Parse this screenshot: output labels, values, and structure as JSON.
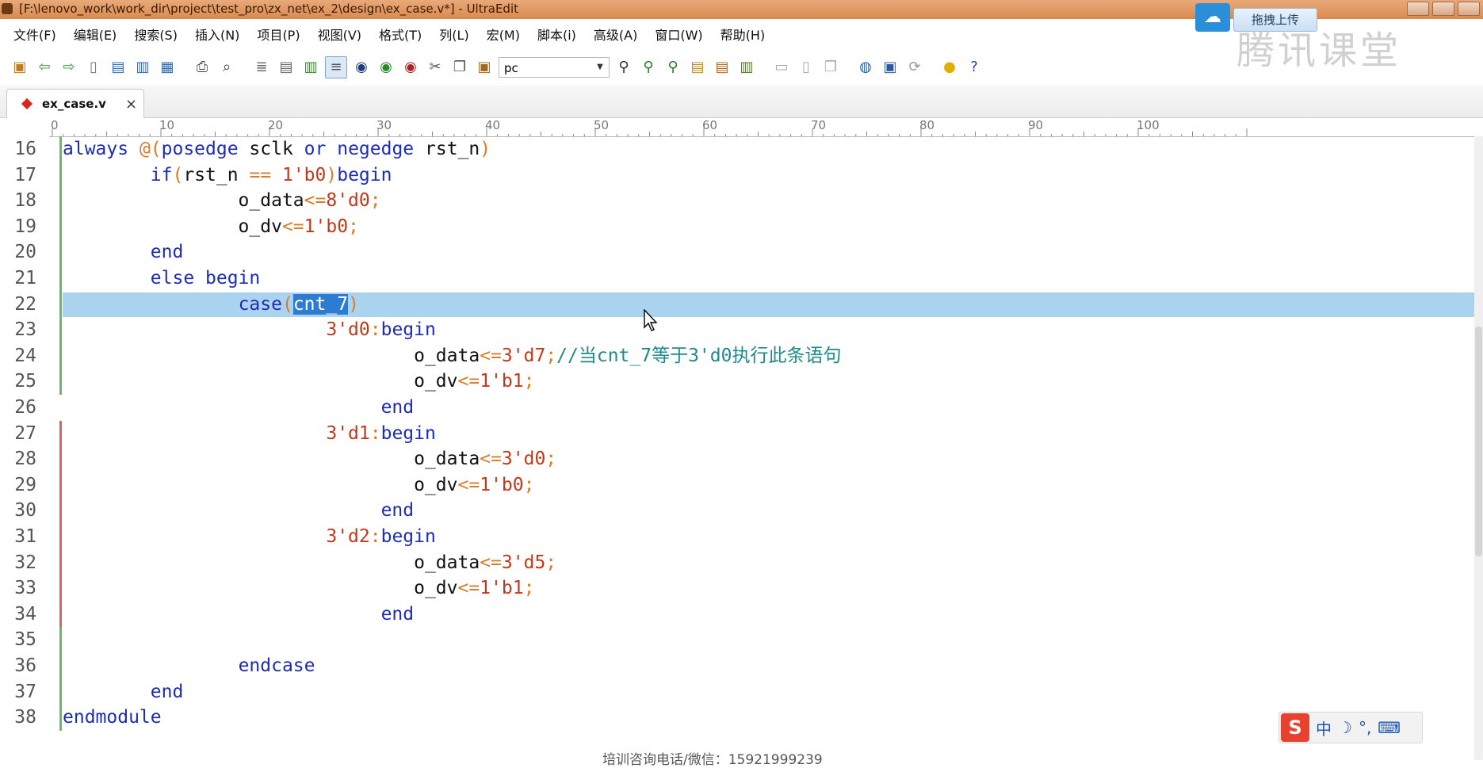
{
  "window": {
    "title": "[F:\\lenovo_work\\work_dir\\project\\test_pro\\zx_net\\ex_2\\design\\ex_case.v*] - UltraEdit"
  },
  "upload": {
    "label": "拖拽上传"
  },
  "brand": {
    "logo_text": "腾讯课堂"
  },
  "menu": {
    "items": [
      {
        "label": "文件(F)"
      },
      {
        "label": "编辑(E)"
      },
      {
        "label": "搜索(S)"
      },
      {
        "label": "插入(N)"
      },
      {
        "label": "项目(P)"
      },
      {
        "label": "视图(V)"
      },
      {
        "label": "格式(T)"
      },
      {
        "label": "列(L)"
      },
      {
        "label": "宏(M)"
      },
      {
        "label": "脚本(i)"
      },
      {
        "label": "高级(A)"
      },
      {
        "label": "窗口(W)"
      },
      {
        "label": "帮助(H)"
      }
    ]
  },
  "toolbar": {
    "combo_value": "pc",
    "icons": [
      "open-project-icon",
      "back-icon",
      "forward-icon",
      "new-file-icon",
      "open-file-icon",
      "save-icon",
      "save-all-icon",
      "print-icon",
      "print-preview-icon",
      "spellcheck-icon",
      "word-count-icon",
      "column-mode-icon",
      "word-wrap-icon",
      "ftp-icon",
      "web-icon",
      "browser-icon",
      "cut-icon",
      "copy-icon",
      "paste-icon"
    ]
  },
  "tabs": [
    {
      "label": "ex_case.v",
      "modified": true
    }
  ],
  "ruler": {
    "labels": [
      "0",
      "10",
      "20",
      "30",
      "40",
      "50",
      "60",
      "70",
      "80",
      "90",
      "100"
    ]
  },
  "editor": {
    "selected_text": "cnt_7",
    "highlighted_line": 22,
    "lines": [
      {
        "n": "16",
        "tokens": [
          [
            "kw",
            "always "
          ],
          [
            "op",
            "@("
          ],
          [
            "kw",
            "posedge "
          ],
          [
            "id",
            "sclk "
          ],
          [
            "kw",
            "or "
          ],
          [
            "kw",
            "negedge "
          ],
          [
            "id",
            "rst_n"
          ],
          [
            "op",
            ")"
          ]
        ]
      },
      {
        "n": "17",
        "tokens": [
          [
            "id",
            "        "
          ],
          [
            "kw",
            "if"
          ],
          [
            "op",
            "("
          ],
          [
            "id",
            "rst_n "
          ],
          [
            "op",
            "== "
          ],
          [
            "num",
            "1'b0"
          ],
          [
            "op",
            ")"
          ],
          [
            "kw",
            "begin"
          ]
        ]
      },
      {
        "n": "18",
        "tokens": [
          [
            "id",
            "                o_data"
          ],
          [
            "op",
            "<="
          ],
          [
            "num",
            "8'd0"
          ],
          [
            "op",
            ";"
          ]
        ]
      },
      {
        "n": "19",
        "tokens": [
          [
            "id",
            "                o_dv"
          ],
          [
            "op",
            "<="
          ],
          [
            "num",
            "1'b0"
          ],
          [
            "op",
            ";"
          ]
        ]
      },
      {
        "n": "20",
        "tokens": [
          [
            "id",
            "        "
          ],
          [
            "kw",
            "end"
          ]
        ]
      },
      {
        "n": "21",
        "tokens": [
          [
            "id",
            "        "
          ],
          [
            "kw",
            "else begin"
          ]
        ]
      },
      {
        "n": "22",
        "tokens": [
          [
            "id",
            "                "
          ],
          [
            "kw",
            "case"
          ],
          [
            "op",
            "("
          ],
          [
            "sel",
            "cnt_7"
          ],
          [
            "op",
            ")"
          ]
        ]
      },
      {
        "n": "23",
        "tokens": [
          [
            "id",
            "                        "
          ],
          [
            "num",
            "3'd0"
          ],
          [
            "op",
            ":"
          ],
          [
            "kw",
            "begin"
          ]
        ]
      },
      {
        "n": "24",
        "tokens": [
          [
            "id",
            "                                o_data"
          ],
          [
            "op",
            "<="
          ],
          [
            "num",
            "3'd7"
          ],
          [
            "op",
            ";"
          ],
          [
            "cm",
            "//当cnt_7等于3'd0执行此条语句"
          ]
        ]
      },
      {
        "n": "25",
        "tokens": [
          [
            "id",
            "                                o_dv"
          ],
          [
            "op",
            "<="
          ],
          [
            "num",
            "1'b1"
          ],
          [
            "op",
            ";"
          ]
        ]
      },
      {
        "n": "26",
        "tokens": [
          [
            "id",
            "                             "
          ],
          [
            "kw",
            "end"
          ]
        ]
      },
      {
        "n": "27",
        "tokens": [
          [
            "id",
            "                        "
          ],
          [
            "num",
            "3'd1"
          ],
          [
            "op",
            ":"
          ],
          [
            "kw",
            "begin"
          ]
        ]
      },
      {
        "n": "28",
        "tokens": [
          [
            "id",
            "                                o_data"
          ],
          [
            "op",
            "<="
          ],
          [
            "num",
            "3'd0"
          ],
          [
            "op",
            ";"
          ]
        ]
      },
      {
        "n": "29",
        "tokens": [
          [
            "id",
            "                                o_dv"
          ],
          [
            "op",
            "<="
          ],
          [
            "num",
            "1'b0"
          ],
          [
            "op",
            ";"
          ]
        ]
      },
      {
        "n": "30",
        "tokens": [
          [
            "id",
            "                             "
          ],
          [
            "kw",
            "end"
          ]
        ]
      },
      {
        "n": "31",
        "tokens": [
          [
            "id",
            "                        "
          ],
          [
            "num",
            "3'd2"
          ],
          [
            "op",
            ":"
          ],
          [
            "kw",
            "begin"
          ]
        ]
      },
      {
        "n": "32",
        "tokens": [
          [
            "id",
            "                                o_data"
          ],
          [
            "op",
            "<="
          ],
          [
            "num",
            "3'd5"
          ],
          [
            "op",
            ";"
          ]
        ]
      },
      {
        "n": "33",
        "tokens": [
          [
            "id",
            "                                o_dv"
          ],
          [
            "op",
            "<="
          ],
          [
            "num",
            "1'b1"
          ],
          [
            "op",
            ";"
          ]
        ]
      },
      {
        "n": "34",
        "tokens": [
          [
            "id",
            "                             "
          ],
          [
            "kw",
            "end"
          ]
        ]
      },
      {
        "n": "35",
        "tokens": []
      },
      {
        "n": "36",
        "tokens": [
          [
            "id",
            "                "
          ],
          [
            "kw",
            "endcase"
          ]
        ]
      },
      {
        "n": "37",
        "tokens": [
          [
            "id",
            "        "
          ],
          [
            "kw",
            "end"
          ]
        ]
      },
      {
        "n": "38",
        "tokens": [
          [
            "kw",
            "endmodule"
          ]
        ]
      }
    ]
  },
  "ime": {
    "logo": "S",
    "mode": "中",
    "moon": "☽",
    "punct": "°,",
    "keyboard": "⌨"
  },
  "footer": {
    "watermark": "培训咨询电话/微信：15921999239"
  },
  "colors": {
    "keyword": "#1d2db3",
    "operator": "#d97d2a",
    "number": "#c0391a",
    "comment": "#1f8a8a",
    "line_highlight": "#aad3ef",
    "selection": "#2e7cd1"
  }
}
